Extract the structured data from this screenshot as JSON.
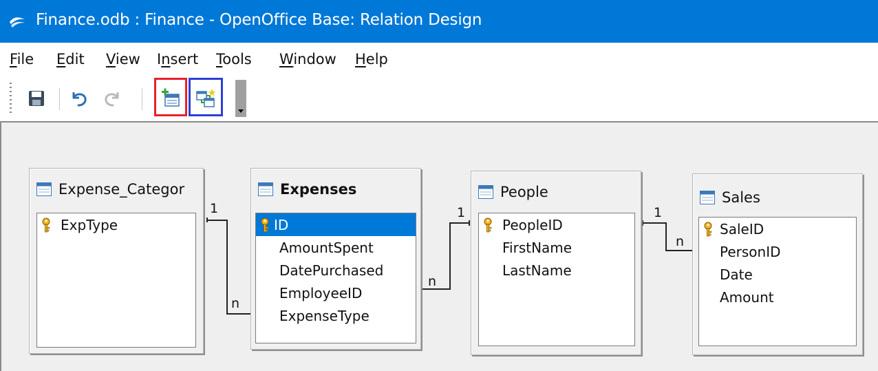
{
  "window": {
    "title": "Finance.odb : Finance - OpenOffice Base: Relation Design"
  },
  "menu": {
    "file": {
      "accel": "F",
      "rest": "ile"
    },
    "edit": {
      "accel": "E",
      "rest": "dit"
    },
    "view": {
      "accel": "V",
      "rest": "iew"
    },
    "insert": {
      "pre": "I",
      "accel": "n",
      "rest": "sert"
    },
    "tools": {
      "accel": "T",
      "rest": "ools"
    },
    "window": {
      "accel": "W",
      "rest": "indow"
    },
    "help": {
      "accel": "H",
      "rest": "elp"
    }
  },
  "toolbar": {
    "icons": [
      "save-icon",
      "undo-icon",
      "redo-icon",
      "add-tables-icon",
      "new-relation-icon",
      "toolbar-options-dropdown"
    ],
    "highlight_colors": {
      "add_tables": "#e8202a",
      "new_relation": "#2c3fd6"
    }
  },
  "tables": {
    "expense_category": {
      "title": "Expense_Categor",
      "fields": [
        "ExpType"
      ]
    },
    "expenses": {
      "title": "Expenses",
      "fields": [
        "ID",
        "AmountSpent",
        "DatePurchased",
        "EmployeeID",
        "ExpenseType"
      ]
    },
    "people": {
      "title": "People",
      "fields": [
        "PeopleID",
        "FirstName",
        "LastName"
      ]
    },
    "sales": {
      "title": "Sales",
      "fields": [
        "SaleID",
        "PersonID",
        "Date",
        "Amount"
      ]
    }
  },
  "relations": {
    "r1": {
      "one": "1",
      "many": "n"
    },
    "r2": {
      "one": "1",
      "many": "n"
    },
    "r3": {
      "one": "1",
      "many": "n"
    }
  },
  "colors": {
    "titlebar": "#0078d7",
    "selection": "#0078d7",
    "canvas": "#efefef"
  }
}
